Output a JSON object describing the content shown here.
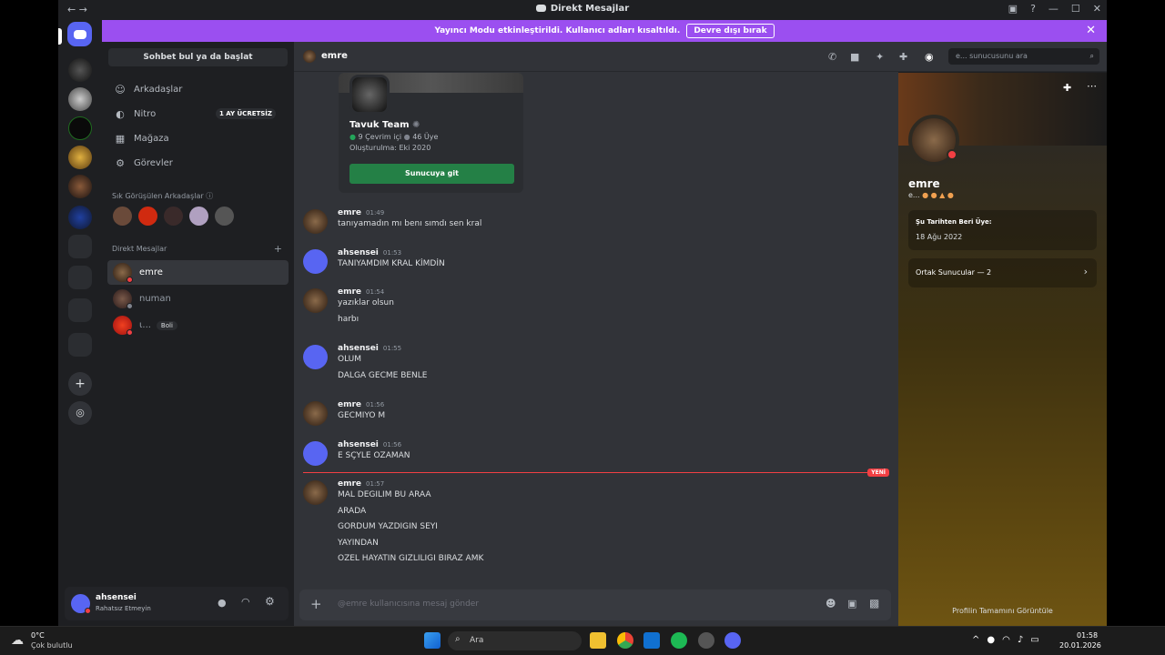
{
  "window": {
    "title": "Direkt Mesajlar",
    "nav": "← →"
  },
  "banner": {
    "text": "Yayıncı Modu etkinleştirildi. Kullanıcı adları kısaltıldı.",
    "button": "Devre dışı bırak"
  },
  "sidebar": {
    "search": "Sohbet bul ya da başlat",
    "nav": [
      {
        "label": "Arkadaşlar",
        "icon": "friends-icon"
      },
      {
        "label": "Nitro",
        "icon": "nitro-icon",
        "badge": "1 AY ÜCRETSİZ"
      },
      {
        "label": "Mağaza",
        "icon": "shop-icon"
      },
      {
        "label": "Görevler",
        "icon": "quests-icon"
      }
    ],
    "frequent_title": "Sık Görüşülen Arkadaşlar",
    "dm_title": "Direkt Mesajlar",
    "dms": [
      {
        "name": "emre",
        "active": true
      },
      {
        "name": "numan",
        "active": false
      },
      {
        "name": "ꙇ...",
        "active": false,
        "tag": "Boli"
      }
    ]
  },
  "user": {
    "name": "ahsensei",
    "status": "Rahatsız Etmeyin"
  },
  "chat": {
    "name": "emre",
    "search_placeholder": "e... sunucusunu ara",
    "invite": {
      "name": "Tavuk Team",
      "online": "9 Çevrim içi",
      "members": "46 Üye",
      "created": "Oluşturulma: Eki 2020",
      "button": "Sunucuya git"
    },
    "new_label": "YENİ",
    "composer_placeholder": "@emre kullanıcısına mesaj gönder",
    "messages": [
      {
        "author": "emre",
        "time": "01:49",
        "lines": [
          "tanıyamadın mı benı sımdı sen kral"
        ]
      },
      {
        "author": "ahsensei",
        "time": "01:53",
        "lines": [
          "TANIYAMDIM KRAL KİMDİN"
        ]
      },
      {
        "author": "emre",
        "time": "01:54",
        "lines": [
          "yazıklar olsun",
          "harbı"
        ]
      },
      {
        "author": "ahsensei",
        "time": "01:55",
        "lines": [
          "OLUM",
          "DALGA GECME BENLE"
        ]
      },
      {
        "author": "emre",
        "time": "01:56",
        "lines": [
          "GECMIYO M"
        ]
      },
      {
        "author": "ahsensei",
        "time": "01:56",
        "lines": [
          "E SÇYLE OZAMAN"
        ]
      },
      {
        "author": "emre",
        "time": "01:57",
        "lines": [
          "MAL DEGILIM BU ARAA",
          "ARADA",
          "GORDUM YAZDIGIN SEYI",
          "YAYINDAN",
          "OZEL HAYATIN GIZLILIGI BIRAZ AMK"
        ]
      }
    ]
  },
  "profile": {
    "name": "emre",
    "sub": "e...",
    "member_since_label": "Şu Tarihten Beri Üye:",
    "member_since": "18 Ağu 2022",
    "mutual": "Ortak Sunucular — 2",
    "view_full": "Profilin Tamamını Görüntüle"
  },
  "taskbar": {
    "temp": "0°C",
    "weather": "Çok bulutlu",
    "search": "Ara",
    "time": "01:58",
    "date": "20.01.2026"
  },
  "colors": {
    "accent": "#5865f2",
    "banner": "#9b4ff0",
    "green": "#248046",
    "new": "#f23f43"
  }
}
